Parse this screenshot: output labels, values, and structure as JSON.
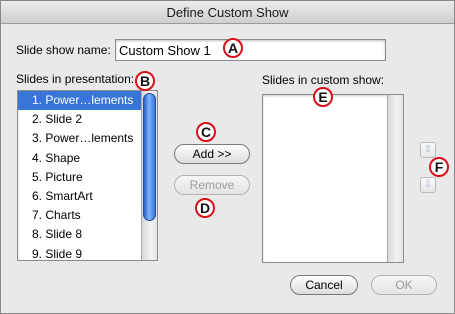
{
  "window": {
    "title": "Define Custom Show"
  },
  "name_field": {
    "label": "Slide show name:",
    "value": "Custom Show 1"
  },
  "presentation": {
    "label": "Slides in presentation:",
    "slides": [
      "1. Power…lements",
      "2. Slide 2",
      "3. Power…lements",
      "4. Shape",
      "5. Picture",
      "6. SmartArt",
      "7. Charts",
      "8. Slide 8",
      "9. Slide 9"
    ],
    "selected_index": 0
  },
  "custom_show": {
    "label": "Slides in custom show:",
    "slides": []
  },
  "buttons": {
    "add": "Add >>",
    "remove": "Remove",
    "cancel": "Cancel",
    "ok": "OK"
  },
  "reorder": {
    "up_icon": "arrow-up-icon",
    "down_icon": "arrow-down-icon"
  },
  "callouts": {
    "a": "A",
    "b": "B",
    "c": "C",
    "d": "D",
    "e": "E",
    "f": "F"
  },
  "colors": {
    "selection": "#3875d7",
    "callout_ring": "#d8101a"
  }
}
